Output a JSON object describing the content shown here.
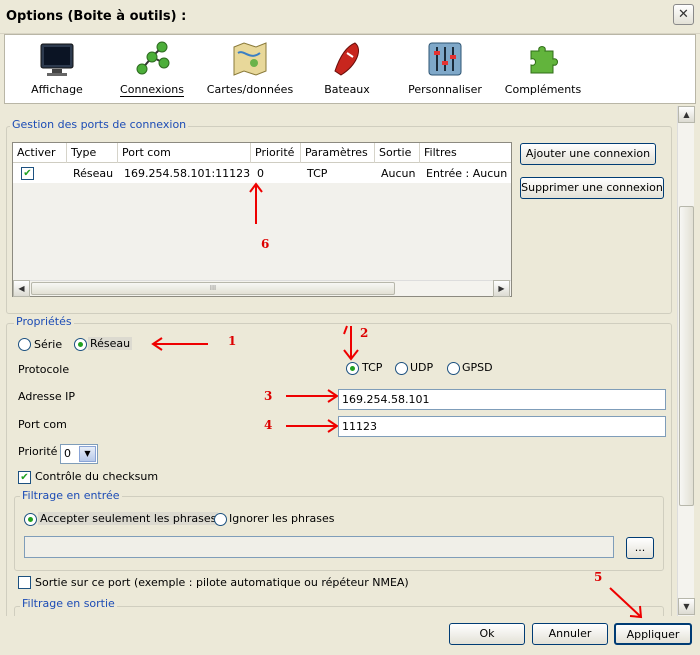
{
  "window": {
    "title": "Options (Boite à outils) :",
    "close_label": "✕"
  },
  "toolbar": {
    "items": [
      {
        "label": "Affichage"
      },
      {
        "label": "Connexions"
      },
      {
        "label": "Cartes/données"
      },
      {
        "label": "Bateaux"
      },
      {
        "label": "Personnaliser"
      },
      {
        "label": "Compléments"
      }
    ]
  },
  "ports": {
    "group_label": "Gestion des ports de connexion",
    "columns": [
      "Activer",
      "Type",
      "Port com",
      "Priorité",
      "Paramètres",
      "Sortie",
      "Filtres"
    ],
    "rows": [
      {
        "active": true,
        "type": "Réseau",
        "port": "169.254.58.101:11123",
        "priority": "0",
        "params": "TCP",
        "output": "Aucun",
        "filters": "Entrée : Aucun fi"
      }
    ],
    "add_button": "Ajouter une connexion",
    "remove_button": "Supprimer une connexion",
    "scroll_grip": "III"
  },
  "props": {
    "group_label": "Propriétés",
    "mode_serie": "Série",
    "mode_reseau": "Réseau",
    "protocol_label": "Protocole",
    "proto_tcp": "TCP",
    "proto_udp": "UDP",
    "proto_gpsd": "GPSD",
    "ip_label": "Adresse IP",
    "ip_value": "169.254.58.101",
    "port_label": "Port com",
    "port_value": "11123",
    "priority_label": "Priorité",
    "priority_value": "0",
    "checksum_label": "Contrôle du checksum"
  },
  "input_filter": {
    "group_label": "Filtrage en entrée",
    "accept_label": "Accepter seulement les phrases",
    "ignore_label": "Ignorer les phrases",
    "phrases_value": "",
    "browse_label": "..."
  },
  "output": {
    "checkbox_label": "Sortie sur ce port (exemple : pilote automatique ou répéteur NMEA)",
    "filter_group_label": "Filtrage en sortie"
  },
  "footer": {
    "ok": "Ok",
    "cancel": "Annuler",
    "apply": "Appliquer"
  },
  "annotations": [
    "1",
    "2",
    "3",
    "4",
    "5",
    "6"
  ]
}
